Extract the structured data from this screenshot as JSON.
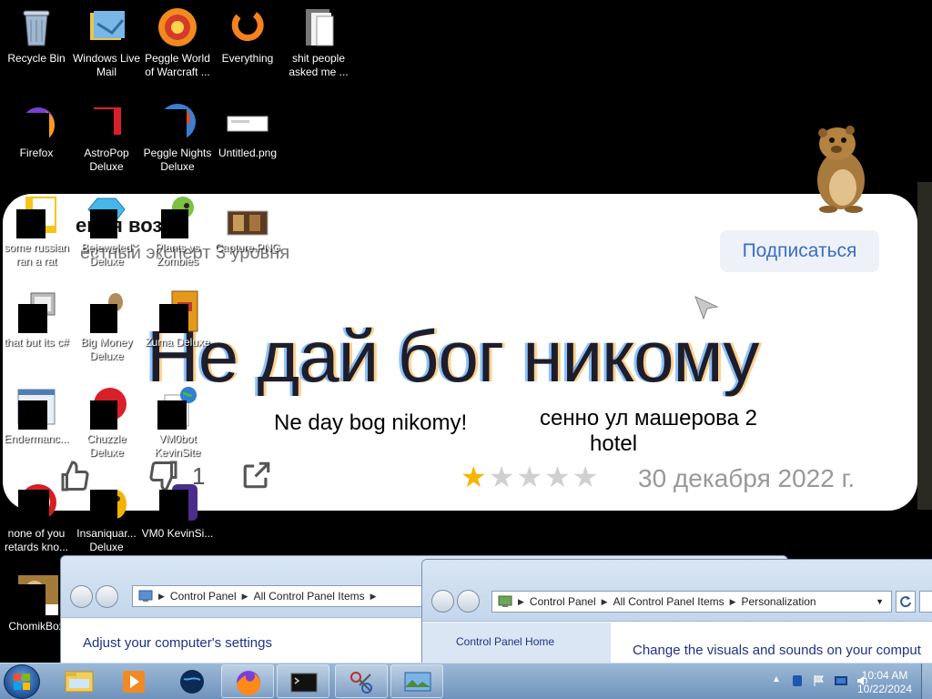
{
  "wallpaper": {
    "author": "ения возд",
    "author_status": "естный эксперт 3 уровня",
    "subscribe_label": "Подписаться",
    "headline": "Не дай бог никому",
    "overlay_transliteration": "Ne day bog nikomy!",
    "overlay_address_line1": "сенно ул машерова 2",
    "overlay_address_line2": "hotel",
    "dislike_count": "1",
    "rating": 1,
    "rating_max": 5,
    "review_date": "30 декабря 2022 г."
  },
  "desktop_icons": [
    {
      "label": "Recycle Bin",
      "icon": "recycle-bin-icon"
    },
    {
      "label": "Windows Live Mail",
      "icon": "mail-icon"
    },
    {
      "label": "Peggle World of Warcraft ...",
      "icon": "peggle-icon"
    },
    {
      "label": "Everything",
      "icon": "search-icon"
    },
    {
      "label": "shit people asked me ...",
      "icon": "folder-icon"
    },
    {
      "label": "Firefox",
      "icon": "firefox-icon"
    },
    {
      "label": "AstroPop Deluxe",
      "icon": "game-icon"
    },
    {
      "label": "Peggle Nights Deluxe",
      "icon": "peggle-icon"
    },
    {
      "label": "Untitled.png",
      "icon": "image-file-icon"
    },
    {
      "label": "some russian ran a rat",
      "icon": "file-icon"
    },
    {
      "label": "Bejeweled Deluxe",
      "icon": "gem-icon"
    },
    {
      "label": "Plants vs Zombies",
      "icon": "plant-icon"
    },
    {
      "label": "Capture.PNG",
      "icon": "image-file-icon"
    },
    {
      "label": "that but its c#",
      "icon": "file-icon"
    },
    {
      "label": "Big Money Deluxe",
      "icon": "money-bag-icon"
    },
    {
      "label": "Zuma Deluxe",
      "icon": "zuma-icon"
    },
    {
      "label": "Endermanc...",
      "icon": "window-icon"
    },
    {
      "label": "Chuzzle Deluxe",
      "icon": "chuzzle-icon"
    },
    {
      "label": "VM0bot KevinSite",
      "icon": "globe-icon"
    },
    {
      "label": "none of you retards kno...",
      "icon": "file-icon"
    },
    {
      "label": "Insaniquar... Deluxe",
      "icon": "game-icon"
    },
    {
      "label": "VM0 KevinSi...",
      "icon": "file-icon"
    },
    {
      "label": "ChomikBox",
      "icon": "hamster-icon"
    }
  ],
  "windows": [
    {
      "address": [
        "Control Panel",
        "All Control Panel Items"
      ],
      "heading": "Adjust your computer's settings"
    },
    {
      "address": [
        "Control Panel",
        "All Control Panel Items",
        "Personalization"
      ],
      "sidebar_link": "Control Panel Home",
      "heading": "Change the visuals and sounds on your comput"
    }
  ],
  "taskbar": {
    "time": "10:04 AM",
    "date": "10/22/2024",
    "buttons": [
      "Windows Explorer",
      "Windows Media Player",
      "Firefox",
      "Command Prompt",
      "Snipping Tool",
      "Control Panel"
    ]
  },
  "colors": {
    "desktop": "#000000",
    "taskbar": "#7c9cc4",
    "link_blue": "#1e3287",
    "star_on": "#f7b500"
  }
}
